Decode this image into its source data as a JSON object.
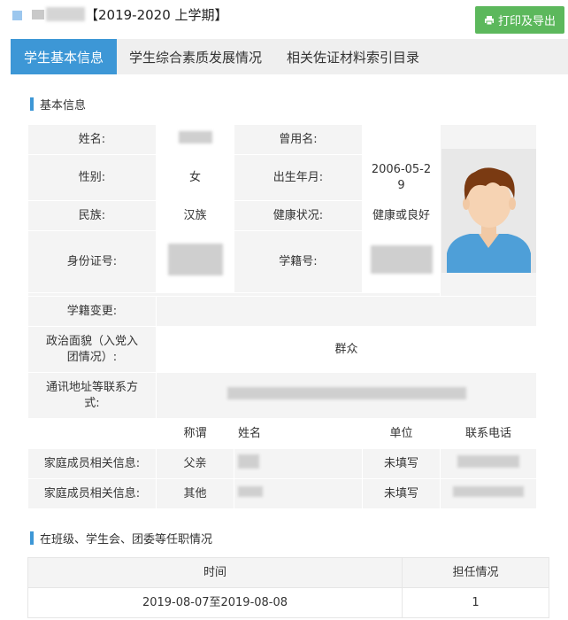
{
  "header": {
    "term": "【2019-2020 上学期】",
    "print_label": "打印及导出"
  },
  "tabs": [
    {
      "label": "学生基本信息",
      "active": true
    },
    {
      "label": "学生综合素质发展情况",
      "active": false
    },
    {
      "label": "相关佐证材料索引目录",
      "active": false
    }
  ],
  "basic": {
    "section_title": "基本信息",
    "name_label": "姓名:",
    "former_name_label": "曾用名:",
    "former_name_value": "",
    "gender_label": "性别:",
    "gender_value": "女",
    "birth_label": "出生年月:",
    "birth_value": "2006-05-29",
    "ethnicity_label": "民族:",
    "ethnicity_value": "汉族",
    "health_label": "健康状况:",
    "health_value": "健康或良好",
    "id_label": "身份证号:",
    "student_no_label": "学籍号:",
    "status_change_label": "学籍变更:",
    "status_change_value": "",
    "political_label": "政治面貌（入党入团情况）:",
    "political_value": "群众",
    "address_label": "通讯地址等联系方式:",
    "family_headers": [
      "称谓",
      "姓名",
      "单位",
      "联系电话"
    ],
    "family": [
      {
        "label": "家庭成员相关信息:",
        "relation": "父亲",
        "unit": "未填写"
      },
      {
        "label": "家庭成员相关信息:",
        "relation": "其他",
        "unit": "未填写"
      }
    ]
  },
  "duty": {
    "section_title": "在班级、学生会、团委等任职情况",
    "headers": [
      "时间",
      "担任情况"
    ],
    "rows": [
      {
        "time": "2019-08-07至2019-08-08",
        "position": "1"
      }
    ]
  },
  "colors": {
    "accent": "#3d97d6",
    "print_button": "#5cb85c",
    "avatar_shirt": "#4e9fd8",
    "avatar_hair": "#7a3a12"
  }
}
